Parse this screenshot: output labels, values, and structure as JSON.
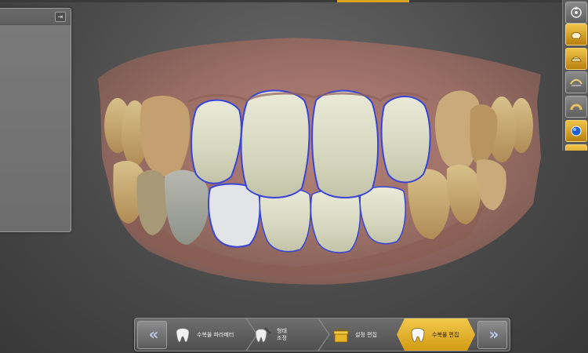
{
  "left_panel": {
    "pin_icon": "pin-icon"
  },
  "right_toolbar": {
    "tools": [
      {
        "name": "view-orientation-tool",
        "icon": "view-orientation-icon",
        "style": "dark"
      },
      {
        "name": "crown-tool",
        "icon": "crown-icon",
        "style": "gold"
      },
      {
        "name": "crown-contour-tool",
        "icon": "crown-contour-icon",
        "style": "gold"
      },
      {
        "name": "margin-tool",
        "icon": "margin-icon",
        "style": "dark"
      },
      {
        "name": "arch-tool",
        "icon": "arch-icon",
        "style": "dark"
      },
      {
        "name": "color-tool",
        "icon": "color-sphere-icon",
        "style": "gold"
      }
    ]
  },
  "workflow": {
    "prev_label": "«",
    "next_label": "»",
    "steps": [
      {
        "label": "수복물 파라메터",
        "icon": "tooth-icon",
        "active": false
      },
      {
        "label_line1": "형태",
        "label_line2": "조정",
        "icon": "tooth-tool-icon",
        "active": false
      },
      {
        "label": "설정 편집",
        "icon": "gift-box-icon",
        "active": false
      },
      {
        "label": "수복물 편집",
        "icon": "tooth-edit-icon",
        "active": true
      }
    ]
  },
  "colors": {
    "accent": "#d9a41e",
    "background": "#4a4a4a",
    "active_step": "#e8b42c"
  }
}
